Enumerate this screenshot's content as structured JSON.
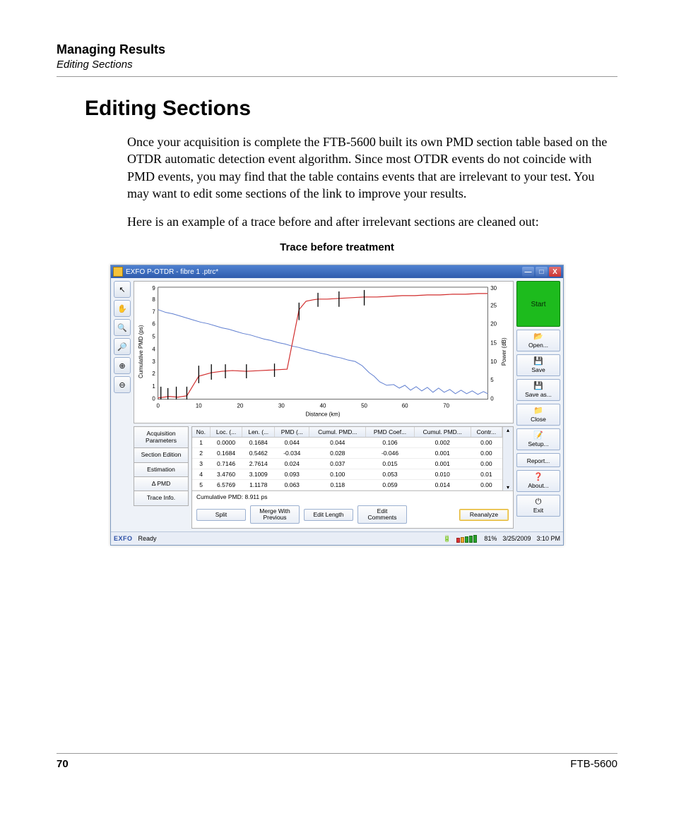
{
  "page": {
    "chapter": "Managing Results",
    "section_header": "Editing Sections",
    "title": "Editing Sections",
    "para1": "Once your acquisition is complete the FTB-5600 built its own PMD section table based on the OTDR automatic detection event algorithm. Since most OTDR events do not coincide with PMD events, you may find that the table contains events that are irrelevant to your test. You may want to edit some sections of the link to improve your results.",
    "para2": "Here is an example of a trace before and after irrelevant sections are cleaned out:",
    "caption": "Trace before treatment",
    "page_number": "70",
    "product": "FTB-5600"
  },
  "app": {
    "title": "EXFO P-OTDR - fibre 1 .ptrc*",
    "titlebar": {
      "min": "—",
      "max": "□",
      "close": "X"
    },
    "tools": {
      "pointer": "↖",
      "hand": "✋",
      "zoom_area": "🔍",
      "zoom_fit": "🔎",
      "zoom_in": "⊕",
      "zoom_out": "⊖"
    },
    "side_tabs": {
      "acq": "Acquisition\nParameters",
      "sec": "Section Edition",
      "est": "Estimation",
      "delta": "Δ PMD",
      "trace": "Trace Info."
    },
    "table": {
      "headers": [
        "No.",
        "Loc. (...",
        "Len. (...",
        "PMD (...",
        "Cumul. PMD...",
        "PMD Coef...",
        "Cumul. PMD...",
        "Contr..."
      ],
      "rows": [
        [
          "1",
          "0.0000",
          "0.1684",
          "0.044",
          "0.044",
          "0.106",
          "0.002",
          "0.00"
        ],
        [
          "2",
          "0.1684",
          "0.5462",
          "-0.034",
          "0.028",
          "-0.046",
          "0.001",
          "0.00"
        ],
        [
          "3",
          "0.7146",
          "2.7614",
          "0.024",
          "0.037",
          "0.015",
          "0.001",
          "0.00"
        ],
        [
          "4",
          "3.4760",
          "3.1009",
          "0.093",
          "0.100",
          "0.053",
          "0.010",
          "0.01"
        ],
        [
          "5",
          "6.5769",
          "1.1178",
          "0.063",
          "0.118",
          "0.059",
          "0.014",
          "0.00"
        ]
      ],
      "scroll_up": "▴",
      "scroll_down": "▾"
    },
    "cumulative_label": "Cumulative PMD: 8.911 ps",
    "actions": {
      "split": "Split",
      "merge": "Merge With\nPrevious",
      "edit_len": "Edit Length",
      "edit_com": "Edit\nComments",
      "reanalyze": "Reanalyze"
    },
    "sidebar_btns": {
      "start": "Start",
      "open": "Open...",
      "save": "Save",
      "saveas": "Save as...",
      "close": "Close",
      "setup": "Setup...",
      "report": "Report...",
      "about": "About...",
      "exit": "Exit"
    },
    "sidebar_icons": {
      "open": "📂",
      "save": "💾",
      "saveas": "💾",
      "close": "📁",
      "setup": "📝",
      "report": "",
      "about": "❓",
      "exit": "⏻"
    },
    "statusbar": {
      "brand": "EXFO",
      "ready": "Ready",
      "battery_pct": "81%",
      "date": "3/25/2009",
      "time": "3:10 PM"
    },
    "chart": {
      "left_label": "Cumulative PMD (ps)",
      "right_label": "Power (dB)",
      "x_label": "Distance (km)",
      "left_ticks": [
        "0",
        "1",
        "2",
        "3",
        "4",
        "5",
        "6",
        "7",
        "8",
        "9"
      ],
      "right_ticks": [
        "0",
        "5",
        "10",
        "15",
        "20",
        "25",
        "30"
      ],
      "x_ticks": [
        "0",
        "10",
        "20",
        "30",
        "40",
        "50",
        "60",
        "70"
      ]
    }
  },
  "chart_data": {
    "type": "line",
    "title": "",
    "xlabel": "Distance (km)",
    "x": [
      0,
      10,
      20,
      30,
      40,
      50,
      60,
      70,
      80
    ],
    "series": [
      {
        "name": "Cumulative PMD (ps)",
        "axis": "left",
        "ylim": [
          0,
          9
        ],
        "values": [
          0.1,
          0.4,
          2.3,
          2.4,
          7.5,
          8.4,
          8.7,
          8.8,
          8.9
        ]
      },
      {
        "name": "Power (dB)",
        "axis": "right",
        "ylim": [
          0,
          30
        ],
        "values": [
          24,
          21,
          18,
          15,
          12,
          9,
          4,
          3,
          2
        ]
      }
    ],
    "left_axis": {
      "label": "Cumulative PMD (ps)",
      "range": [
        0,
        9
      ]
    },
    "right_axis": {
      "label": "Power (dB)",
      "range": [
        0,
        30
      ]
    },
    "x_axis_range": [
      0,
      80
    ]
  }
}
